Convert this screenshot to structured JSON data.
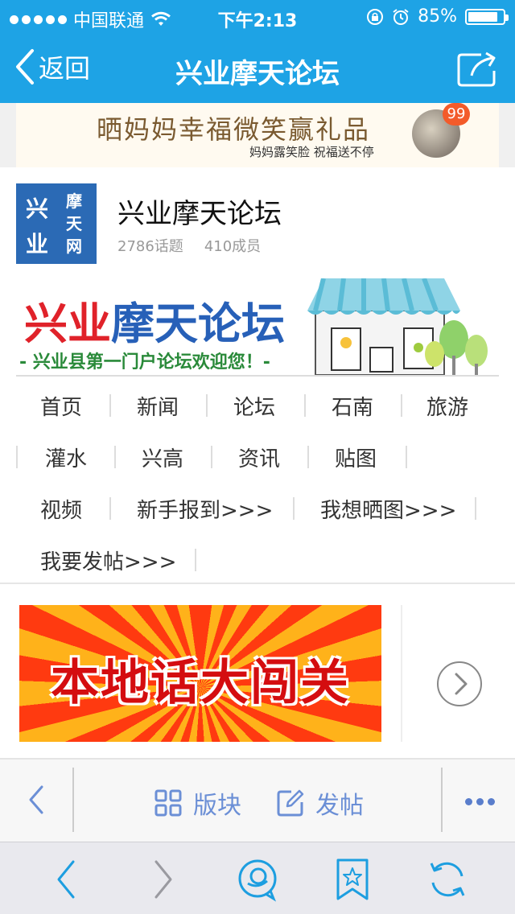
{
  "status_bar": {
    "carrier": "中国联通",
    "time": "下午2:13",
    "battery_text": "85%",
    "battery_level": 0.85
  },
  "nav_bar": {
    "back_label": "返回",
    "title": "兴业摩天论坛"
  },
  "ad_banner": {
    "main_text": "晒妈妈幸福微笑赢礼品",
    "sub_text": "妈妈露笑脸 祝福送不停",
    "badge_count": "99"
  },
  "forum": {
    "logo_chars": [
      "兴",
      "业",
      "摩",
      "天",
      "网"
    ],
    "name": "兴业摩天论坛",
    "topics": "2786话题",
    "members": "410成员"
  },
  "logo_banner": {
    "title_red": "兴业",
    "title_blue": "摩天论坛",
    "slogan": "- 兴业县第一门户论坛欢迎您！-"
  },
  "nav_links": {
    "row1": [
      "首页",
      "新闻",
      "论坛",
      "石南",
      "旅游"
    ],
    "row2": [
      "灌水",
      "兴高",
      "资讯",
      "贴图"
    ],
    "row3": [
      "视频",
      "新手报到>>>",
      "我想晒图>>>"
    ],
    "row4": [
      "我要发帖>>>"
    ]
  },
  "promo": {
    "text": "本地话大闯关"
  },
  "toolbar": {
    "blocks_label": "版块",
    "post_label": "发帖"
  },
  "colors": {
    "header_blue": "#1ea3e5",
    "toolbar_blue": "#6b8fd6",
    "browser_icon_blue": "#1d9ee0"
  }
}
